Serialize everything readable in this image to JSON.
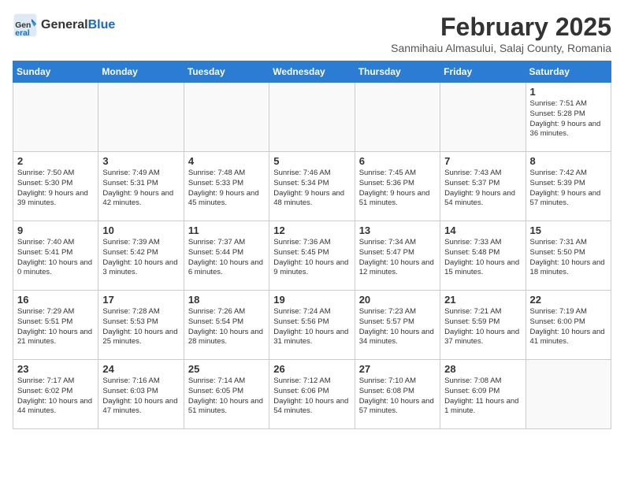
{
  "header": {
    "logo_general": "General",
    "logo_blue": "Blue",
    "month_title": "February 2025",
    "subtitle": "Sanmihaiu Almasului, Salaj County, Romania"
  },
  "days_of_week": [
    "Sunday",
    "Monday",
    "Tuesday",
    "Wednesday",
    "Thursday",
    "Friday",
    "Saturday"
  ],
  "weeks": [
    [
      {
        "day": "",
        "info": ""
      },
      {
        "day": "",
        "info": ""
      },
      {
        "day": "",
        "info": ""
      },
      {
        "day": "",
        "info": ""
      },
      {
        "day": "",
        "info": ""
      },
      {
        "day": "",
        "info": ""
      },
      {
        "day": "1",
        "info": "Sunrise: 7:51 AM\nSunset: 5:28 PM\nDaylight: 9 hours and 36 minutes."
      }
    ],
    [
      {
        "day": "2",
        "info": "Sunrise: 7:50 AM\nSunset: 5:30 PM\nDaylight: 9 hours and 39 minutes."
      },
      {
        "day": "3",
        "info": "Sunrise: 7:49 AM\nSunset: 5:31 PM\nDaylight: 9 hours and 42 minutes."
      },
      {
        "day": "4",
        "info": "Sunrise: 7:48 AM\nSunset: 5:33 PM\nDaylight: 9 hours and 45 minutes."
      },
      {
        "day": "5",
        "info": "Sunrise: 7:46 AM\nSunset: 5:34 PM\nDaylight: 9 hours and 48 minutes."
      },
      {
        "day": "6",
        "info": "Sunrise: 7:45 AM\nSunset: 5:36 PM\nDaylight: 9 hours and 51 minutes."
      },
      {
        "day": "7",
        "info": "Sunrise: 7:43 AM\nSunset: 5:37 PM\nDaylight: 9 hours and 54 minutes."
      },
      {
        "day": "8",
        "info": "Sunrise: 7:42 AM\nSunset: 5:39 PM\nDaylight: 9 hours and 57 minutes."
      }
    ],
    [
      {
        "day": "9",
        "info": "Sunrise: 7:40 AM\nSunset: 5:41 PM\nDaylight: 10 hours and 0 minutes."
      },
      {
        "day": "10",
        "info": "Sunrise: 7:39 AM\nSunset: 5:42 PM\nDaylight: 10 hours and 3 minutes."
      },
      {
        "day": "11",
        "info": "Sunrise: 7:37 AM\nSunset: 5:44 PM\nDaylight: 10 hours and 6 minutes."
      },
      {
        "day": "12",
        "info": "Sunrise: 7:36 AM\nSunset: 5:45 PM\nDaylight: 10 hours and 9 minutes."
      },
      {
        "day": "13",
        "info": "Sunrise: 7:34 AM\nSunset: 5:47 PM\nDaylight: 10 hours and 12 minutes."
      },
      {
        "day": "14",
        "info": "Sunrise: 7:33 AM\nSunset: 5:48 PM\nDaylight: 10 hours and 15 minutes."
      },
      {
        "day": "15",
        "info": "Sunrise: 7:31 AM\nSunset: 5:50 PM\nDaylight: 10 hours and 18 minutes."
      }
    ],
    [
      {
        "day": "16",
        "info": "Sunrise: 7:29 AM\nSunset: 5:51 PM\nDaylight: 10 hours and 21 minutes."
      },
      {
        "day": "17",
        "info": "Sunrise: 7:28 AM\nSunset: 5:53 PM\nDaylight: 10 hours and 25 minutes."
      },
      {
        "day": "18",
        "info": "Sunrise: 7:26 AM\nSunset: 5:54 PM\nDaylight: 10 hours and 28 minutes."
      },
      {
        "day": "19",
        "info": "Sunrise: 7:24 AM\nSunset: 5:56 PM\nDaylight: 10 hours and 31 minutes."
      },
      {
        "day": "20",
        "info": "Sunrise: 7:23 AM\nSunset: 5:57 PM\nDaylight: 10 hours and 34 minutes."
      },
      {
        "day": "21",
        "info": "Sunrise: 7:21 AM\nSunset: 5:59 PM\nDaylight: 10 hours and 37 minutes."
      },
      {
        "day": "22",
        "info": "Sunrise: 7:19 AM\nSunset: 6:00 PM\nDaylight: 10 hours and 41 minutes."
      }
    ],
    [
      {
        "day": "23",
        "info": "Sunrise: 7:17 AM\nSunset: 6:02 PM\nDaylight: 10 hours and 44 minutes."
      },
      {
        "day": "24",
        "info": "Sunrise: 7:16 AM\nSunset: 6:03 PM\nDaylight: 10 hours and 47 minutes."
      },
      {
        "day": "25",
        "info": "Sunrise: 7:14 AM\nSunset: 6:05 PM\nDaylight: 10 hours and 51 minutes."
      },
      {
        "day": "26",
        "info": "Sunrise: 7:12 AM\nSunset: 6:06 PM\nDaylight: 10 hours and 54 minutes."
      },
      {
        "day": "27",
        "info": "Sunrise: 7:10 AM\nSunset: 6:08 PM\nDaylight: 10 hours and 57 minutes."
      },
      {
        "day": "28",
        "info": "Sunrise: 7:08 AM\nSunset: 6:09 PM\nDaylight: 11 hours and 1 minute."
      },
      {
        "day": "",
        "info": ""
      }
    ]
  ]
}
